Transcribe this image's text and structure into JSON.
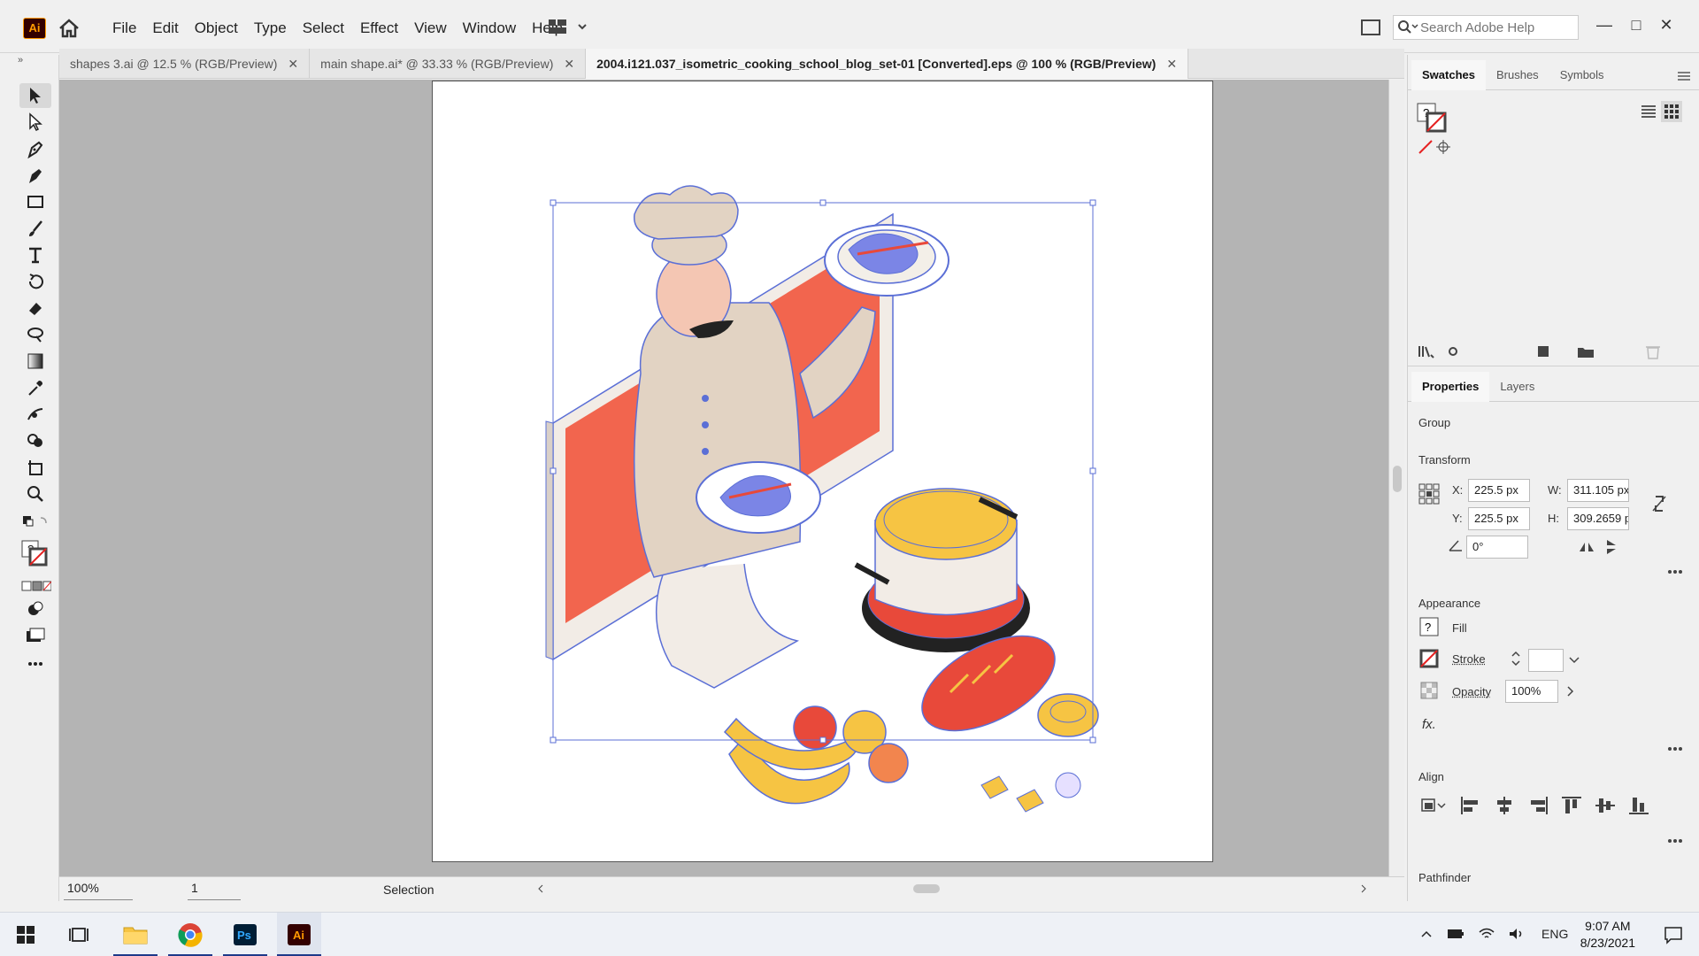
{
  "app": {
    "logo_text": "Ai",
    "menu": [
      "File",
      "Edit",
      "Object",
      "Type",
      "Select",
      "Effect",
      "View",
      "Window",
      "Help"
    ],
    "search_placeholder": "Search Adobe Help"
  },
  "tabs": [
    {
      "label": "shapes 3.ai @ 12.5 % (RGB/Preview)",
      "active": false
    },
    {
      "label": "main shape.ai* @ 33.33 % (RGB/Preview)",
      "active": false
    },
    {
      "label": "2004.i121.037_isometric_cooking_school_blog_set-01 [Converted].eps @ 100 % (RGB/Preview)",
      "active": true
    }
  ],
  "status": {
    "zoom": "100%",
    "artboard_number": "1",
    "current_tool": "Selection"
  },
  "swatches_panel": {
    "tabs": [
      "Swatches",
      "Brushes",
      "Symbols"
    ],
    "active_tab": "Swatches"
  },
  "properties_panel": {
    "tabs": [
      "Properties",
      "Layers"
    ],
    "active_tab": "Properties",
    "selection_type": "Group",
    "transform": {
      "title": "Transform",
      "x_label": "X:",
      "x_value": "225.5 px",
      "y_label": "Y:",
      "y_value": "225.5 px",
      "w_label": "W:",
      "w_value": "311.105 px",
      "h_label": "H:",
      "h_value": "309.2659 px",
      "angle_value": "0°"
    },
    "appearance": {
      "title": "Appearance",
      "fill_label": "Fill",
      "stroke_label": "Stroke",
      "opacity_label": "Opacity",
      "opacity_value": "100%",
      "fx_label": "fx."
    },
    "align_title": "Align",
    "pathfinder_title": "Pathfinder"
  },
  "taskbar": {
    "language": "ENG",
    "time": "9:07 AM",
    "date": "8/23/2021"
  },
  "colors": {
    "selection_blue": "#5b6fd6",
    "screen_red": "#f2654e",
    "chef_beige": "#e2d3c3",
    "banana_yellow": "#f6c443",
    "pot_red": "#e8493a"
  }
}
